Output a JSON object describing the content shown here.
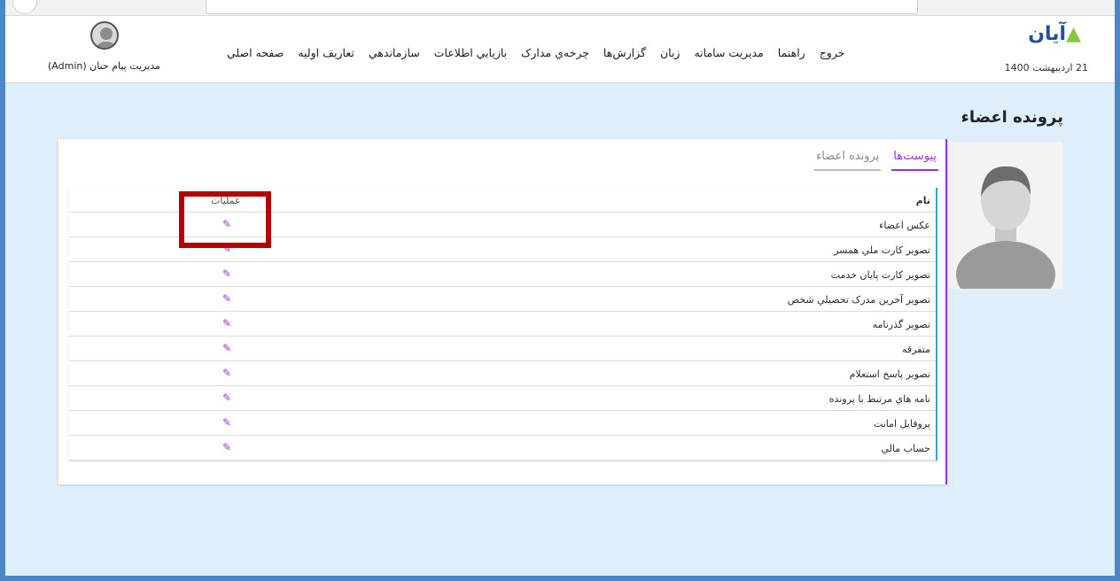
{
  "app": {
    "logo_text": "آیان",
    "date": "21 اردیبهشت 1400",
    "user": "مدیریت پیام حنان (Admin)"
  },
  "menu": {
    "items": [
      "صفحه اصلي",
      "تعاريف اوليه",
      "سازماندهي",
      "بازيابي اطلاعات",
      "چرخه‌ي مدارک",
      "گزارش‌ها",
      "زبان",
      "مديريت سامانه",
      "راهنما",
      "خروج"
    ]
  },
  "page": {
    "title": "پرونده اعضاء"
  },
  "tabs": [
    {
      "label": "پرونده اعضاء",
      "active": false
    },
    {
      "label": "پیوست‌ها",
      "active": true
    }
  ],
  "grid": {
    "header_name": "نام",
    "header_action": "عمليات",
    "rows": [
      "عكس اعضاء",
      "تصوير كارت ملي همسر",
      "تصوير كارت پايان خدمت",
      "تصوير آخرين مدرک تحصيلي شخص",
      "تصوير گذرنامه",
      "متفرقه",
      "تصوير پاسخ استعلام",
      "نامه هاي مرتبط با پرونده",
      "پروفايل امانت",
      "حساب مالي"
    ]
  },
  "colors": {
    "accent": "#9b30e0",
    "grid_border": "#2fa6da",
    "highlight": "#b90000",
    "background": "#dfeefb"
  },
  "icons": {
    "edit": "edit-icon",
    "avatar": "user-avatar-icon"
  }
}
